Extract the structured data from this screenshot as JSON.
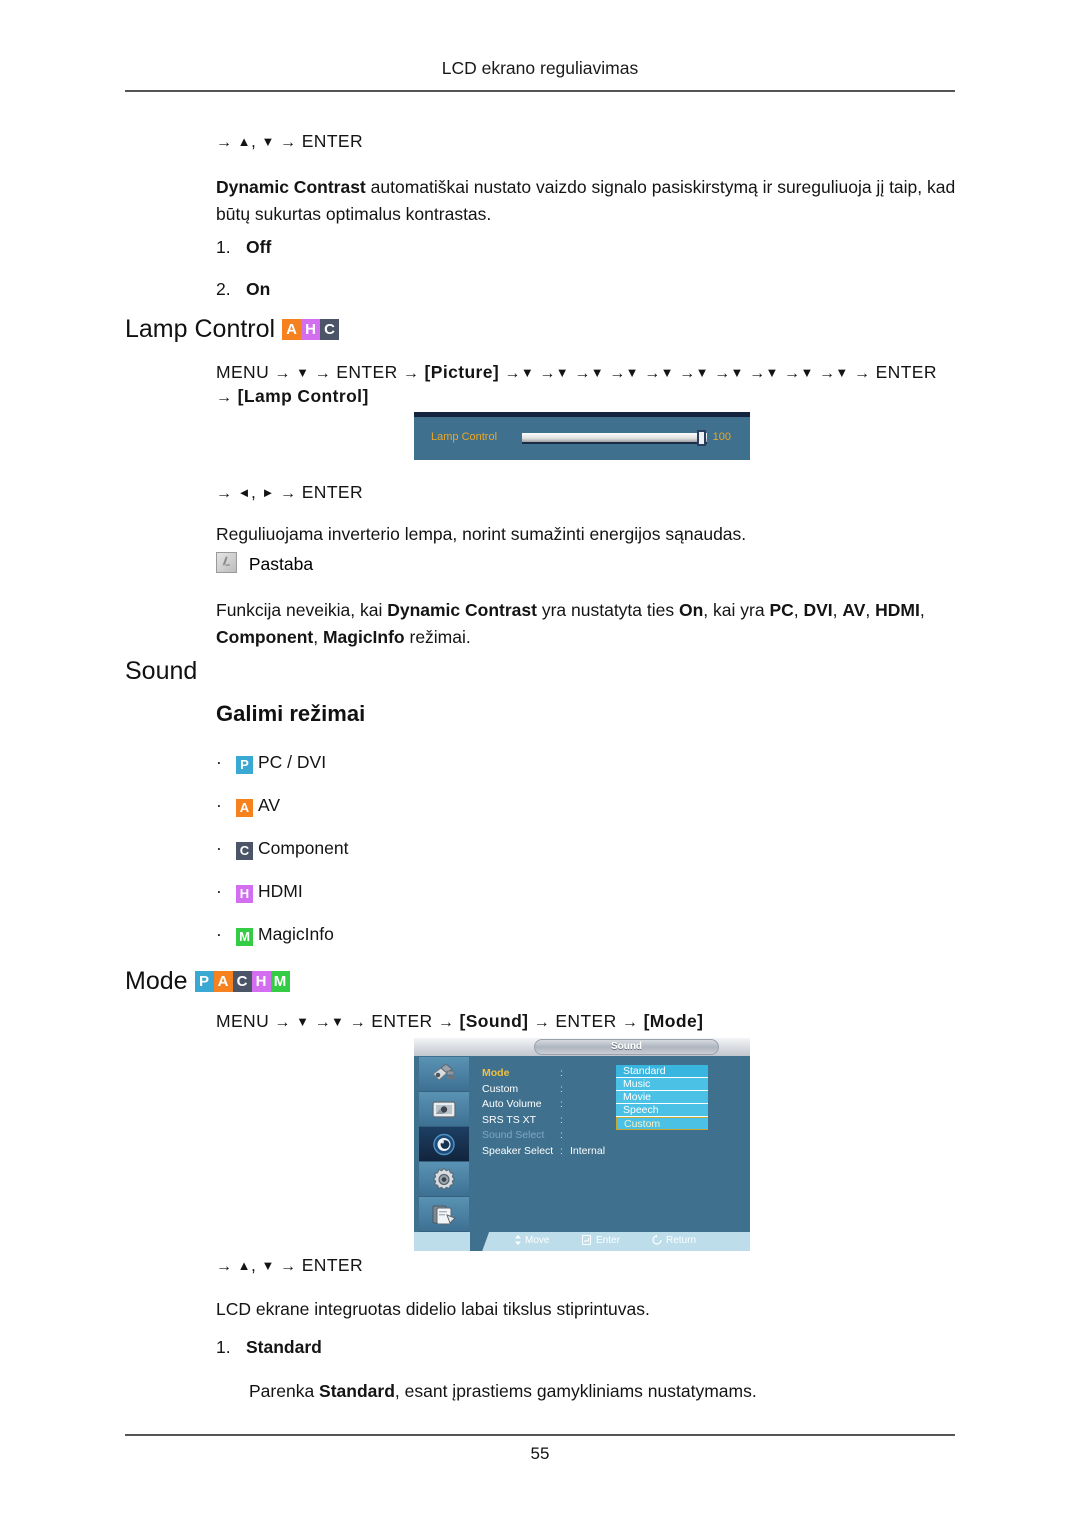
{
  "header": {
    "running_title": "LCD ekrano reguliavimas"
  },
  "footer": {
    "page_number": "55"
  },
  "colors": {
    "badge_pc": "#39a9d4",
    "badge_av": "#f5821f",
    "badge_component": "#4c5468",
    "badge_hdmi": "#d36ef0",
    "badge_magicinfo": "#33cc44",
    "osd_panel": "#3f708e",
    "osd_accent": "#e8a72c",
    "osd_dropdown": "#4cc1e6",
    "osd_bottom_bar": "#bcdde9"
  },
  "dynamic_contrast": {
    "nav_prefix": "→",
    "nav_up": "▲",
    "nav_comma": ",",
    "nav_down": "▼",
    "nav_arrow": "→",
    "nav_enter": "ENTER",
    "description_bold": "Dynamic Contrast",
    "description_rest": " automatiškai nustato vaizdo signalo pasiskirstymą ir sureguliuoja jį taip, kad būtų sukurtas optimalus kontrastas.",
    "options": [
      {
        "number": "1.",
        "label": "Off"
      },
      {
        "number": "2.",
        "label": "On"
      }
    ]
  },
  "lamp_control": {
    "heading": "Lamp Control",
    "badges": [
      {
        "letter": "A",
        "name": "badge-av",
        "color": "#f5821f"
      },
      {
        "letter": "H",
        "name": "badge-hdmi",
        "color": "#d36ef0"
      },
      {
        "letter": "C",
        "name": "badge-component",
        "color": "#4c5468"
      }
    ],
    "menu_path": {
      "menu": "MENU",
      "enter": "ENTER",
      "picture": "[Picture]",
      "lamp_control": "[Lamp Control]",
      "arrow": "→",
      "down": "▼",
      "down_count_after_picture": 10
    },
    "osd": {
      "label": "Lamp Control",
      "value": "100",
      "slider_percent": 100
    },
    "nav_lr": {
      "arrow": "→",
      "left": "◄",
      "comma": ",",
      "right": "►",
      "enter": "ENTER"
    },
    "description": "Reguliuojama inverterio lempa, norint sumažinti energijos sąnaudas.",
    "note_label": "Pastaba",
    "note_text_parts": [
      {
        "text": "Funkcija neveikia, kai ",
        "bold": false
      },
      {
        "text": "Dynamic Contrast",
        "bold": true
      },
      {
        "text": " yra nustatyta ties ",
        "bold": false
      },
      {
        "text": "On",
        "bold": true
      },
      {
        "text": ", kai yra ",
        "bold": false
      },
      {
        "text": "PC",
        "bold": true
      },
      {
        "text": ", ",
        "bold": false
      },
      {
        "text": "DVI",
        "bold": true
      },
      {
        "text": ", ",
        "bold": false
      },
      {
        "text": "AV",
        "bold": true
      },
      {
        "text": ", ",
        "bold": false
      },
      {
        "text": "HDMI",
        "bold": true
      },
      {
        "text": ", ",
        "bold": false
      },
      {
        "text": "Component",
        "bold": true
      },
      {
        "text": ", ",
        "bold": false
      },
      {
        "text": "MagicInfo",
        "bold": true
      },
      {
        "text": " režimai.",
        "bold": false
      }
    ],
    "note_line1": "Funkcija neveikia, kai Dynamic Contrast yra nustatyta ties On, kai yra PC, DVI, AV, HDMI,",
    "note_line2": "Component, MagicInfo režimai."
  },
  "sound": {
    "heading": "Sound",
    "available_modes_heading": "Galimi režimai",
    "available_modes": [
      {
        "badge": "P",
        "badge_name": "badge-pc",
        "color": "#39a9d4",
        "label": "PC / DVI"
      },
      {
        "badge": "A",
        "badge_name": "badge-av",
        "color": "#f5821f",
        "label": "AV"
      },
      {
        "badge": "C",
        "badge_name": "badge-component",
        "color": "#4c5468",
        "label": "Component"
      },
      {
        "badge": "H",
        "badge_name": "badge-hdmi",
        "color": "#d36ef0",
        "label": "HDMI"
      },
      {
        "badge": "M",
        "badge_name": "badge-magicinfo",
        "color": "#33cc44",
        "label": "MagicInfo"
      }
    ]
  },
  "mode": {
    "heading": "Mode",
    "badges": [
      {
        "letter": "P",
        "name": "badge-pc",
        "color": "#39a9d4"
      },
      {
        "letter": "A",
        "name": "badge-av",
        "color": "#f5821f"
      },
      {
        "letter": "C",
        "name": "badge-component",
        "color": "#4c5468"
      },
      {
        "letter": "H",
        "name": "badge-hdmi",
        "color": "#d36ef0"
      },
      {
        "letter": "M",
        "name": "badge-magicinfo",
        "color": "#33cc44"
      }
    ],
    "menu_path": {
      "menu": "MENU",
      "enter": "ENTER",
      "sound": "[Sound]",
      "mode": "[Mode]",
      "arrow": "→",
      "down": "▼"
    },
    "osd": {
      "title": "Sound",
      "icons": [
        {
          "name": "input-source-icon",
          "active": false
        },
        {
          "name": "picture-icon",
          "active": false
        },
        {
          "name": "sound-icon",
          "active": true
        },
        {
          "name": "setup-gear-icon",
          "active": false
        },
        {
          "name": "multi-control-icon",
          "active": false
        }
      ],
      "items": [
        {
          "name": "Mode",
          "value": "",
          "selected": true,
          "disabled": false
        },
        {
          "name": "Custom",
          "value": "",
          "selected": false,
          "disabled": false
        },
        {
          "name": "Auto Volume",
          "value": "",
          "selected": false,
          "disabled": false
        },
        {
          "name": "SRS TS XT",
          "value": "",
          "selected": false,
          "disabled": false
        },
        {
          "name": "Sound Select",
          "value": "",
          "selected": false,
          "disabled": true
        },
        {
          "name": "Speaker Select",
          "value": "Internal",
          "selected": false,
          "disabled": false
        }
      ],
      "colon": ":",
      "dropdown_options": [
        {
          "label": "Standard",
          "current": false
        },
        {
          "label": "Music",
          "current": false
        },
        {
          "label": "Movie",
          "current": false
        },
        {
          "label": "Speech",
          "current": false
        },
        {
          "label": "Custom",
          "current": true
        }
      ],
      "bottom_hints": [
        {
          "icon": "updown-arrow-icon",
          "label": "Move"
        },
        {
          "icon": "enter-key-icon",
          "label": "Enter"
        },
        {
          "icon": "return-arrow-icon",
          "label": "Return"
        }
      ]
    },
    "nav_ud": {
      "arrow": "→",
      "up": "▲",
      "comma": ",",
      "down": "▼",
      "enter": "ENTER"
    },
    "description": "LCD ekrane integruotas didelio labai tikslus stiprintuvas.",
    "option": {
      "number": "1.",
      "label": "Standard"
    },
    "option_desc_pre": "Parenka ",
    "option_desc_bold": "Standard",
    "option_desc_post": ", esant įprastiems gamykliniams nustatymams."
  }
}
